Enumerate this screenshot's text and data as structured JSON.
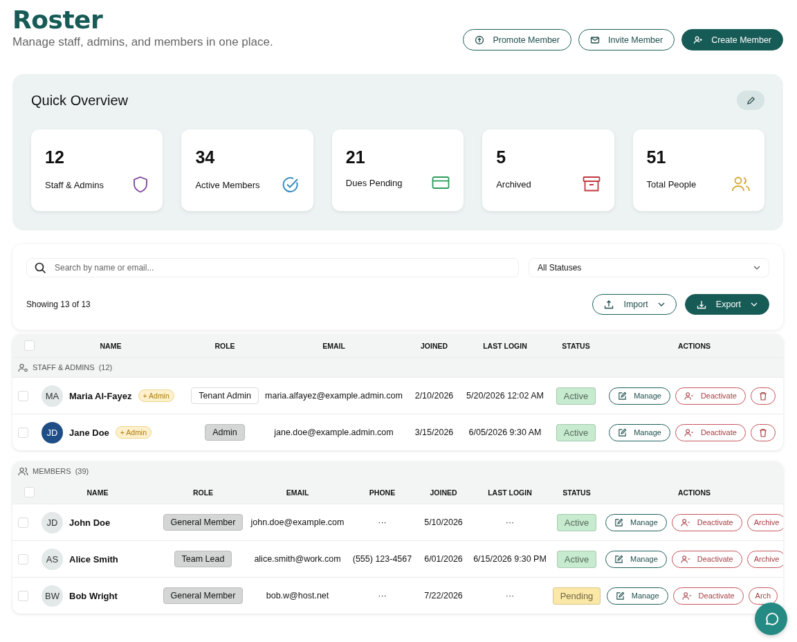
{
  "header": {
    "title": "Roster",
    "subtitle": "Manage staff, admins, and members in one place.",
    "buttons": [
      {
        "label": "Promote Member",
        "kind": "promote",
        "primary": false
      },
      {
        "label": "Invite Member",
        "kind": "invite",
        "primary": false
      },
      {
        "label": "Create Member",
        "kind": "create",
        "primary": true
      }
    ]
  },
  "overview": {
    "title": "Quick Overview",
    "stats": [
      {
        "value": "12",
        "label": "Staff & Admins",
        "kind": "shield",
        "color": "#7b3f98"
      },
      {
        "value": "34",
        "label": "Active Members",
        "kind": "check",
        "color": "#3a8fc0"
      },
      {
        "value": "21",
        "label": "Dues Pending",
        "kind": "card",
        "color": "#2e9b5b"
      },
      {
        "value": "5",
        "label": "Archived",
        "kind": "archive",
        "color": "#c0393f"
      },
      {
        "value": "51",
        "label": "Total People",
        "kind": "people",
        "color": "#d4a72c"
      }
    ]
  },
  "toolbar": {
    "search": {
      "placeholder": "Search by name or email..."
    },
    "status_filter": "All Statuses",
    "count": "Showing 13 of 13",
    "import": "Import",
    "export": "Export"
  },
  "staff": {
    "group": "STAFF & ADMINS",
    "count": "(12)",
    "all_checked": false,
    "columns": [
      "NAME",
      "ROLE",
      "EMAIL",
      "JOINED",
      "LAST LOGIN",
      "STATUS",
      "ACTIONS"
    ],
    "rows": [
      {
        "avatar": {
          "initials": "MA",
          "color": "#e3e8e8"
        },
        "name": "Maria Al-Fayez",
        "tag": "+ Admin",
        "role": {
          "text": "Tenant Admin",
          "outlined": true
        },
        "email": "maria.alfayez@example.admin.com",
        "joined": "2/10/2026",
        "last_login": "5/20/2026 12:02 AM",
        "status": {
          "text": "Active",
          "color": "#c6ebcf"
        },
        "checked": false,
        "actions": [
          {
            "label": "Manage",
            "kind": "manage"
          },
          {
            "label": "Deactivate",
            "kind": "deactivate"
          },
          {
            "kind": "delete"
          }
        ]
      },
      {
        "avatar": {
          "initials": "JD",
          "color": "#1f4e87"
        },
        "name": "Jane Doe",
        "tag": "+ Admin",
        "role": {
          "text": "Admin",
          "outlined": false
        },
        "email": "jane.doe@example.admin.com",
        "joined": "3/15/2026",
        "last_login": "6/05/2026 9:30 AM",
        "status": {
          "text": "Active",
          "color": "#c6ebcf"
        },
        "checked": false,
        "actions": [
          {
            "label": "Manage",
            "kind": "manage"
          },
          {
            "label": "Deactivate",
            "kind": "deactivate"
          },
          {
            "kind": "delete"
          }
        ]
      }
    ]
  },
  "members": {
    "group": "MEMBERS",
    "count": "(39)",
    "all_checked": false,
    "columns": [
      "NAME",
      "ROLE",
      "EMAIL",
      "PHONE",
      "JOINED",
      "LAST LOGIN",
      "STATUS",
      "ACTIONS"
    ],
    "rows": [
      {
        "avatar": {
          "initials": "JD",
          "color": "#e3e8e8"
        },
        "name": "John Doe",
        "role": {
          "text": "General Member",
          "outlined": false
        },
        "email": "john.doe@example.com",
        "phone": "···",
        "joined": "5/10/2026",
        "last_login": "···",
        "status": {
          "text": "Active",
          "color": "#c6ebcf"
        },
        "checked": false,
        "actions": [
          {
            "label": "Manage",
            "kind": "manage"
          },
          {
            "label": "Deactivate",
            "kind": "deactivate"
          },
          {
            "label": "Archive",
            "kind": "archive"
          }
        ]
      },
      {
        "avatar": {
          "initials": "AS",
          "color": "#e3e8e8"
        },
        "name": "Alice Smith",
        "role": {
          "text": "Team Lead",
          "outlined": false
        },
        "email": "alice.smith@work.com",
        "phone": "(555) 123-4567",
        "joined": "6/01/2026",
        "last_login": "6/15/2026 9:30 PM",
        "status": {
          "text": "Active",
          "color": "#c6ebcf"
        },
        "checked": false,
        "actions": [
          {
            "label": "Manage",
            "kind": "manage"
          },
          {
            "label": "Deactivate",
            "kind": "deactivate"
          },
          {
            "label": "Archive",
            "kind": "archive"
          }
        ]
      },
      {
        "avatar": {
          "initials": "BW",
          "color": "#e3e8e8"
        },
        "name": "Bob Wright",
        "role": {
          "text": "General Member",
          "outlined": false
        },
        "email": "bob.w@host.net",
        "phone": "···",
        "joined": "7/22/2026",
        "last_login": "···",
        "status": {
          "text": "Pending",
          "color": "#fbe8a6"
        },
        "checked": false,
        "actions": [
          {
            "label": "Manage",
            "kind": "manage"
          },
          {
            "label": "Deactivate",
            "kind": "deactivate"
          },
          {
            "label": "Arch",
            "kind": "archive"
          }
        ]
      }
    ]
  }
}
